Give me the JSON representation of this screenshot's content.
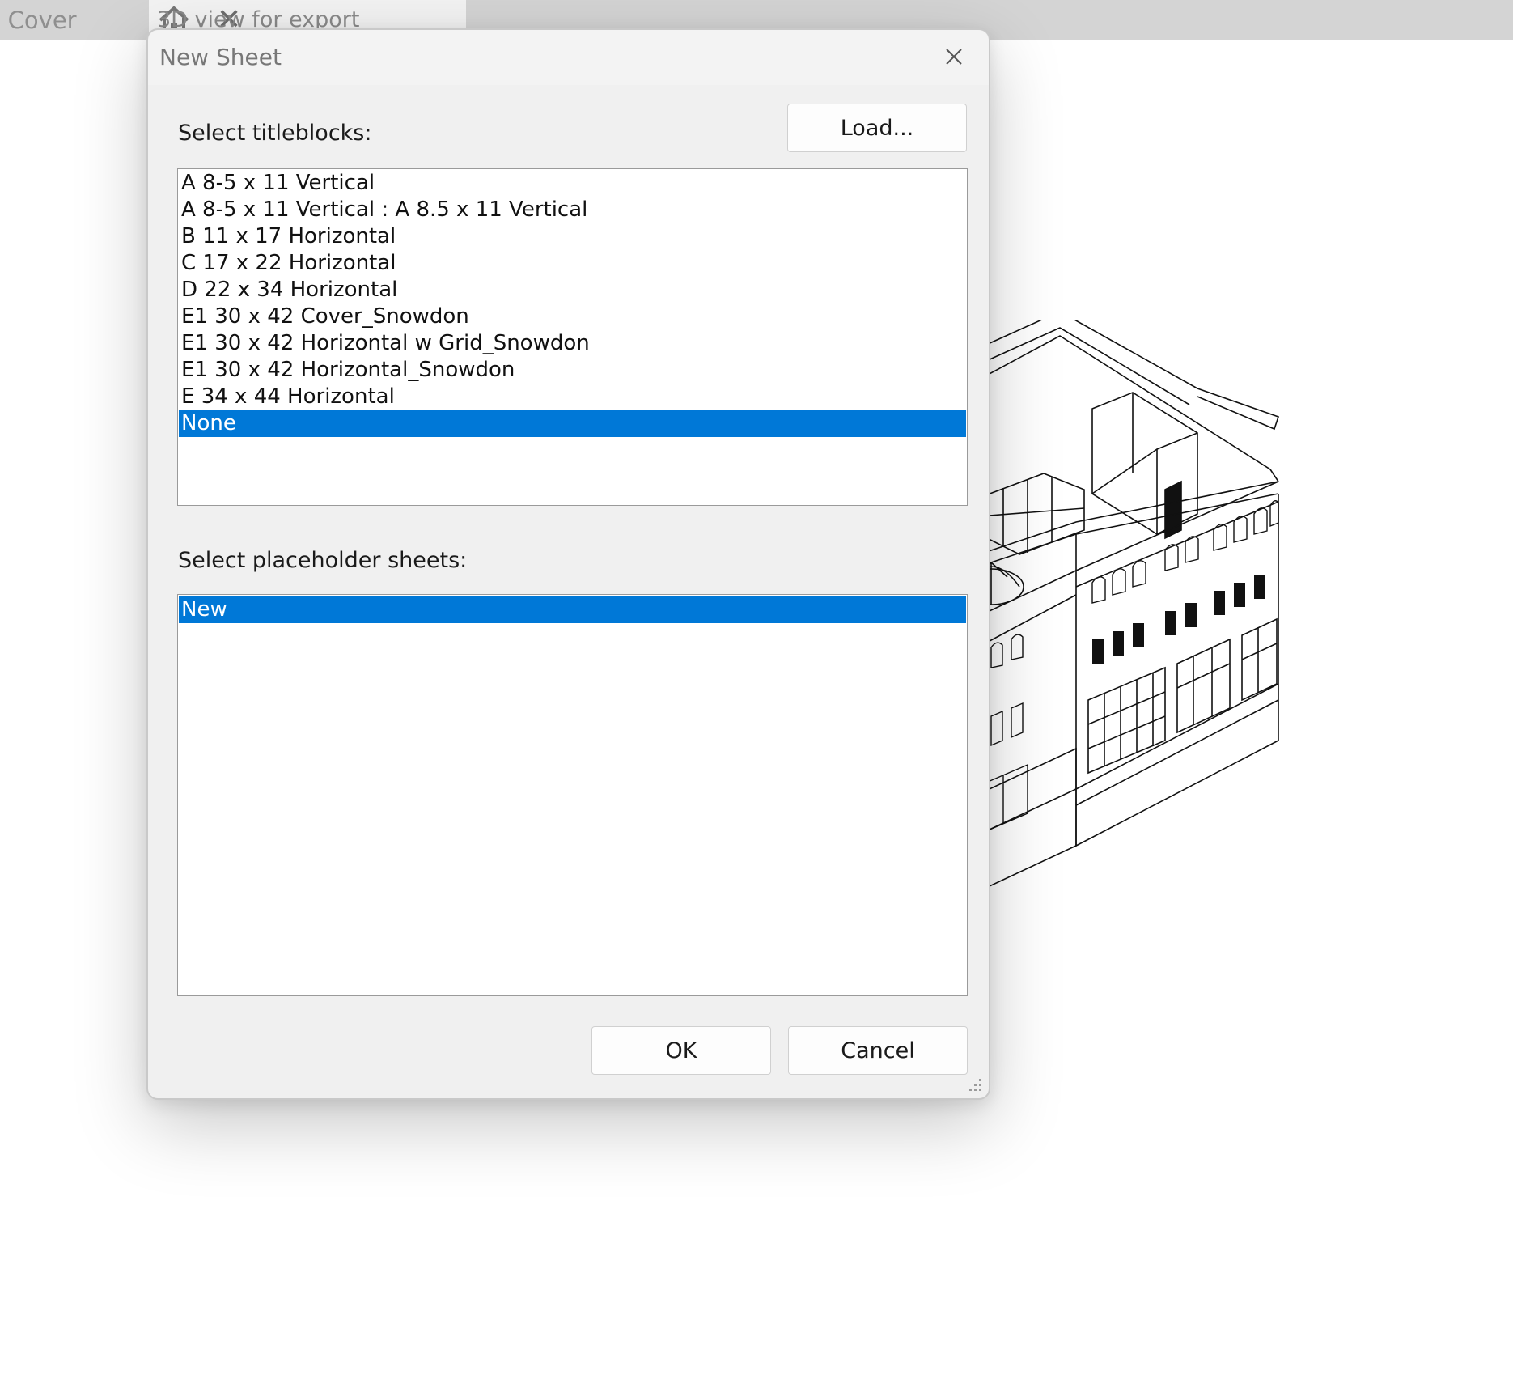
{
  "tabs": [
    {
      "label": "- Cover",
      "active": false
    },
    {
      "label": "3D view for export",
      "active": true
    }
  ],
  "dialog": {
    "title": "New Sheet",
    "titleblocks_label": "Select titleblocks:",
    "load_button": "Load...",
    "titleblocks": [
      "A 8-5 x 11 Vertical",
      "A 8-5 x 11 Vertical : A 8.5 x 11 Vertical",
      "B 11 x 17 Horizontal",
      "C 17 x 22 Horizontal",
      "D 22 x 34 Horizontal",
      "E1 30 x 42 Cover_Snowdon",
      "E1 30 x 42 Horizontal w Grid_Snowdon",
      "E1 30 x 42 Horizontal_Snowdon",
      "E 34 x 44 Horizontal",
      "None"
    ],
    "titleblocks_selected": "None",
    "placeholder_label": "Select placeholder sheets:",
    "placeholder_sheets": [
      "New"
    ],
    "placeholder_selected": "New",
    "ok_button": "OK",
    "cancel_button": "Cancel"
  },
  "colors": {
    "selection": "#0078d7",
    "dialog_bg": "#f0f0f0",
    "tabbar_bg": "#d4d4d4"
  },
  "icons": [
    "home-icon",
    "close-icon",
    "resize-grip-icon"
  ]
}
